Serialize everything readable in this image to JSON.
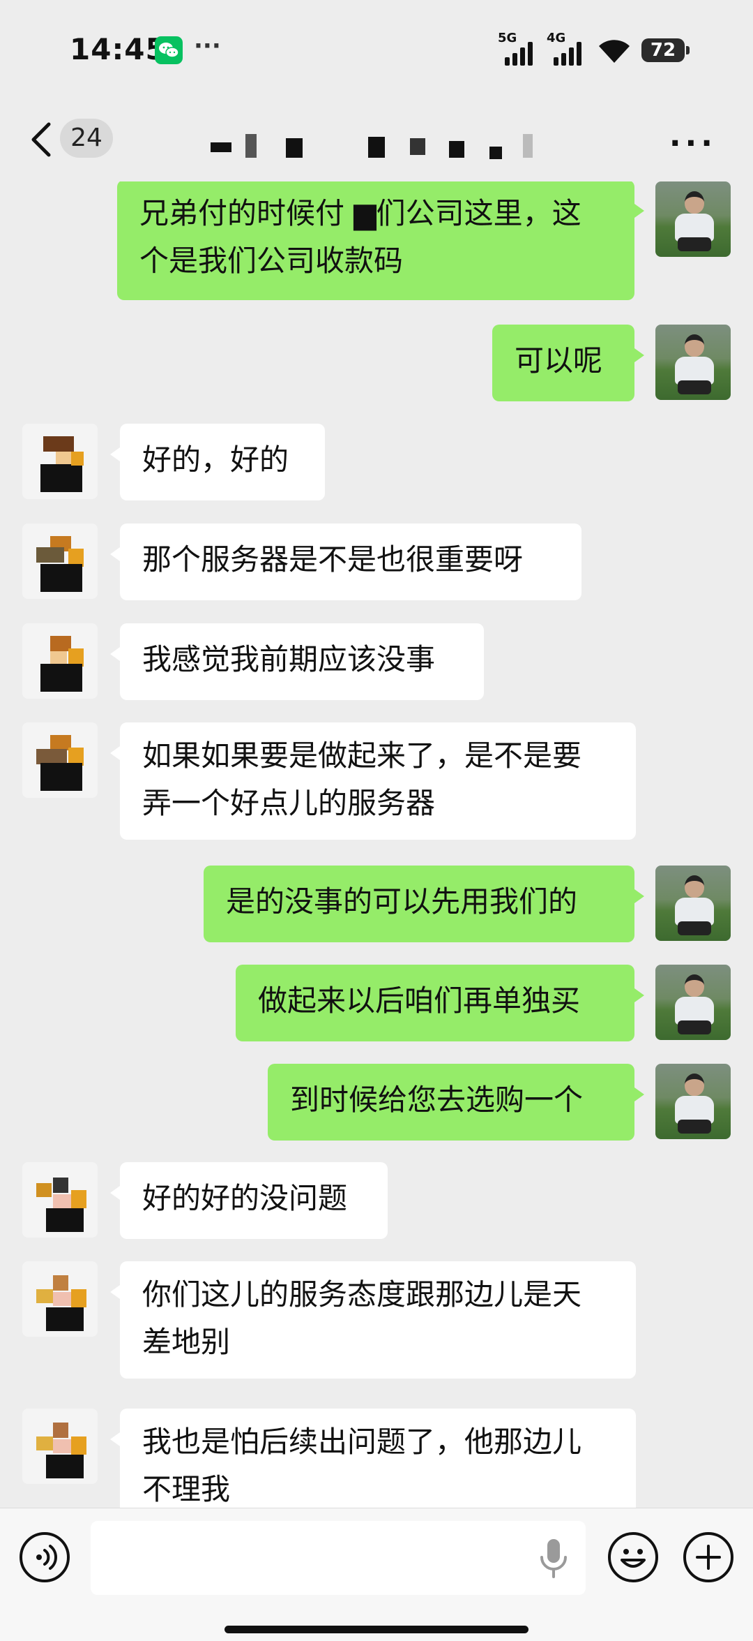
{
  "status_bar": {
    "time": "14:45",
    "signal1": "5G",
    "signal2": "4G",
    "battery": "72",
    "overflow": "···",
    "wechat_icon": "wechat-icon"
  },
  "nav": {
    "unread_count": "24",
    "more_label": "···"
  },
  "colors": {
    "background": "#ededed",
    "my_bubble": "#95ec69",
    "their_bubble": "#ffffff"
  },
  "messages": [
    {
      "sender": "me",
      "lines": [
        "兄弟付的时候付 ▆们公司这里，这",
        "个是我们公司收款码"
      ]
    },
    {
      "sender": "me",
      "lines": [
        "可以呢"
      ]
    },
    {
      "sender": "them",
      "lines": [
        "好的，好的"
      ]
    },
    {
      "sender": "them",
      "lines": [
        "那个服务器是不是也很重要呀"
      ]
    },
    {
      "sender": "them",
      "lines": [
        "我感觉我前期应该没事"
      ]
    },
    {
      "sender": "them",
      "lines": [
        "如果如果要是做起来了，是不是要",
        "弄一个好点儿的服务器"
      ]
    },
    {
      "sender": "me",
      "lines": [
        "是的没事的可以先用我们的"
      ]
    },
    {
      "sender": "me",
      "lines": [
        "做起来以后咱们再单独买"
      ]
    },
    {
      "sender": "me",
      "lines": [
        "到时候给您去选购一个"
      ]
    },
    {
      "sender": "them",
      "lines": [
        "好的好的没问题"
      ]
    },
    {
      "sender": "them",
      "lines": [
        "你们这儿的服务态度跟那边儿是天",
        "差地别"
      ]
    },
    {
      "sender": "them",
      "lines": [
        "我也是怕后续出问题了，他那边儿",
        "不理我"
      ]
    }
  ],
  "input_bar": {
    "placeholder": "",
    "icons": [
      "voice-icon",
      "mic-icon",
      "emoji-icon",
      "plus-icon"
    ]
  }
}
